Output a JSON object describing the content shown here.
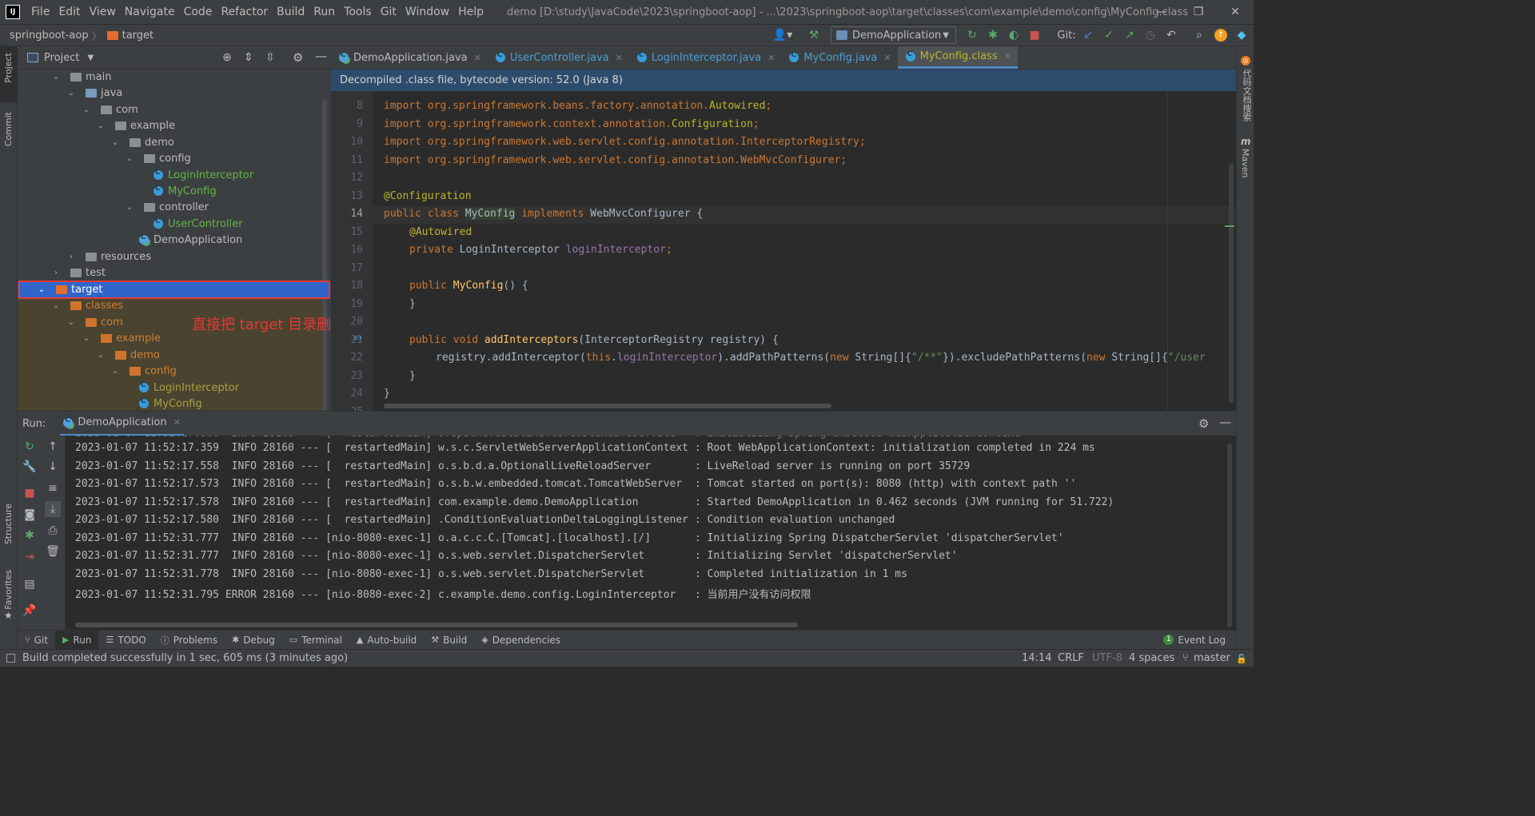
{
  "menu": {
    "items": [
      "File",
      "Edit",
      "View",
      "Navigate",
      "Code",
      "Refactor",
      "Build",
      "Run",
      "Tools",
      "Git",
      "Window",
      "Help"
    ],
    "window_title": "demo [D:\\study\\JavaCode\\2023\\springboot-aop] - ...\\2023\\springboot-aop\\target\\classes\\com\\example\\demo\\config\\MyConfig.class"
  },
  "breadcrumb": {
    "project": "springboot-aop",
    "folder": "target"
  },
  "toolbar": {
    "run_config": "DemoApplication",
    "git_label": "Git:"
  },
  "left_stripe": {
    "project": "Project",
    "commit": "Commit",
    "structure": "Structure",
    "favorites": "Favorites"
  },
  "right_stripe": {
    "plugin": "代码文档搜索",
    "maven": "Maven"
  },
  "project_panel": {
    "title": "Project",
    "annotation": "直接把 target 目录删除",
    "tree": [
      {
        "label": "main",
        "kind": "folder"
      },
      {
        "label": "java",
        "kind": "folder-blue"
      },
      {
        "label": "com",
        "kind": "package"
      },
      {
        "label": "example",
        "kind": "package"
      },
      {
        "label": "demo",
        "kind": "package"
      },
      {
        "label": "config",
        "kind": "package"
      },
      {
        "label": "LoginInterceptor",
        "kind": "class"
      },
      {
        "label": "MyConfig",
        "kind": "class"
      },
      {
        "label": "controller",
        "kind": "package"
      },
      {
        "label": "UserController",
        "kind": "class"
      },
      {
        "label": "DemoApplication",
        "kind": "class-run"
      },
      {
        "label": "resources",
        "kind": "folder-res"
      },
      {
        "label": "test",
        "kind": "folder"
      },
      {
        "label": "target",
        "kind": "folder-excluded"
      },
      {
        "label": "classes",
        "kind": "folder-excluded"
      },
      {
        "label": "com",
        "kind": "folder-excluded"
      },
      {
        "label": "example",
        "kind": "folder-excluded"
      },
      {
        "label": "demo",
        "kind": "folder-excluded"
      },
      {
        "label": "config",
        "kind": "folder-excluded"
      },
      {
        "label": "LoginInterceptor",
        "kind": "class"
      },
      {
        "label": "MyConfig",
        "kind": "class"
      }
    ]
  },
  "editor": {
    "tabs": [
      {
        "label": "DemoApplication.java"
      },
      {
        "label": "UserController.java"
      },
      {
        "label": "LoginInterceptor.java"
      },
      {
        "label": "MyConfig.java"
      },
      {
        "label": "MyConfig.class"
      }
    ],
    "banner": "Decompiled .class file, bytecode version: 52.0 (Java 8)",
    "line_numbers": [
      "8",
      "9",
      "10",
      "11",
      "12",
      "13",
      "14",
      "15",
      "16",
      "17",
      "18",
      "19",
      "20",
      "21",
      "22",
      "23",
      "24",
      "25"
    ],
    "code": {
      "l8a": "import org.springframework.beans.factory.annotation.",
      "l8b": "Autowired",
      "l8c": ";",
      "l9a": "import org.springframework.context.annotation.",
      "l9b": "Configuration",
      "l9c": ";",
      "l10a": "import org.springframework.web.servlet.config.annotation.InterceptorRegistry",
      "l10b": ";",
      "l11a": "import org.springframework.web.servlet.config.annotation.WebMvcConfigurer",
      "l11b": ";",
      "l13": "@Configuration",
      "l14a": "public class ",
      "l14b": "MyConfig",
      "l14c": " implements ",
      "l14d": "WebMvcConfigurer {",
      "l15": "@Autowired",
      "l16a": "private ",
      "l16b": "LoginInterceptor ",
      "l16c": "loginInterceptor",
      "l16d": ";",
      "l18a": "public ",
      "l18b": "MyConfig",
      "l18c": "() {",
      "l19": "}",
      "l21a": "public void ",
      "l21b": "addInterceptors",
      "l21c": "(InterceptorRegistry registry) {",
      "l22a": "registry.addInterceptor(",
      "l22b": "this",
      "l22c": ".",
      "l22d": "loginInterceptor",
      "l22e": ").addPathPatterns(",
      "l22f": "new ",
      "l22g": "String[]{",
      "l22h": "\"/**\"",
      "l22i": "}).excludePathPatterns(",
      "l22j": "new ",
      "l22k": "String[]{",
      "l22l": "\"/user",
      "l23": "}",
      "l24": "}"
    }
  },
  "run_panel": {
    "label": "Run:",
    "tab": "DemoApplication",
    "logs": [
      "2023-01-07 11:52:17.359  INFO 28160 --- [  restartedMain] w.s.c.ServletWebServerApplicationContext : Root WebApplicationContext: initialization completed in 224 ms",
      "2023-01-07 11:52:17.558  INFO 28160 --- [  restartedMain] o.s.b.d.a.OptionalLiveReloadServer       : LiveReload server is running on port 35729",
      "2023-01-07 11:52:17.573  INFO 28160 --- [  restartedMain] o.s.b.w.embedded.tomcat.TomcatWebServer  : Tomcat started on port(s): 8080 (http) with context path ''",
      "2023-01-07 11:52:17.578  INFO 28160 --- [  restartedMain] com.example.demo.DemoApplication         : Started DemoApplication in 0.462 seconds (JVM running for 51.722)",
      "2023-01-07 11:52:17.580  INFO 28160 --- [  restartedMain] .ConditionEvaluationDeltaLoggingListener : Condition evaluation unchanged",
      "2023-01-07 11:52:31.777  INFO 28160 --- [nio-8080-exec-1] o.a.c.c.C.[Tomcat].[localhost].[/]       : Initializing Spring DispatcherServlet 'dispatcherServlet'",
      "2023-01-07 11:52:31.777  INFO 28160 --- [nio-8080-exec-1] o.s.web.servlet.DispatcherServlet        : Initializing Servlet 'dispatcherServlet'",
      "2023-01-07 11:52:31.778  INFO 28160 --- [nio-8080-exec-1] o.s.web.servlet.DispatcherServlet        : Completed initialization in 1 ms",
      "2023-01-07 11:52:31.795 ERROR 28160 --- [nio-8080-exec-2] c.example.demo.config.LoginInterceptor   : 当前用户没有访问权限"
    ]
  },
  "bottom_tools": {
    "git": "Git",
    "run": "Run",
    "todo": "TODO",
    "problems": "Problems",
    "debug": "Debug",
    "terminal": "Terminal",
    "autobuild": "Auto-build",
    "build": "Build",
    "dependencies": "Dependencies",
    "event_log": "Event Log",
    "event_log_count": "1"
  },
  "status": {
    "message": "Build completed successfully in 1 sec, 605 ms (3 minutes ago)",
    "position": "14:14",
    "line_sep": "CRLF",
    "encoding": "UTF-8",
    "indent": "4 spaces",
    "branch": "master"
  },
  "colors": {
    "annotation_red": "#e53935",
    "selection_blue": "#2f65ca",
    "keyword": "#cc7832",
    "annotation_yellow": "#bbb529"
  }
}
